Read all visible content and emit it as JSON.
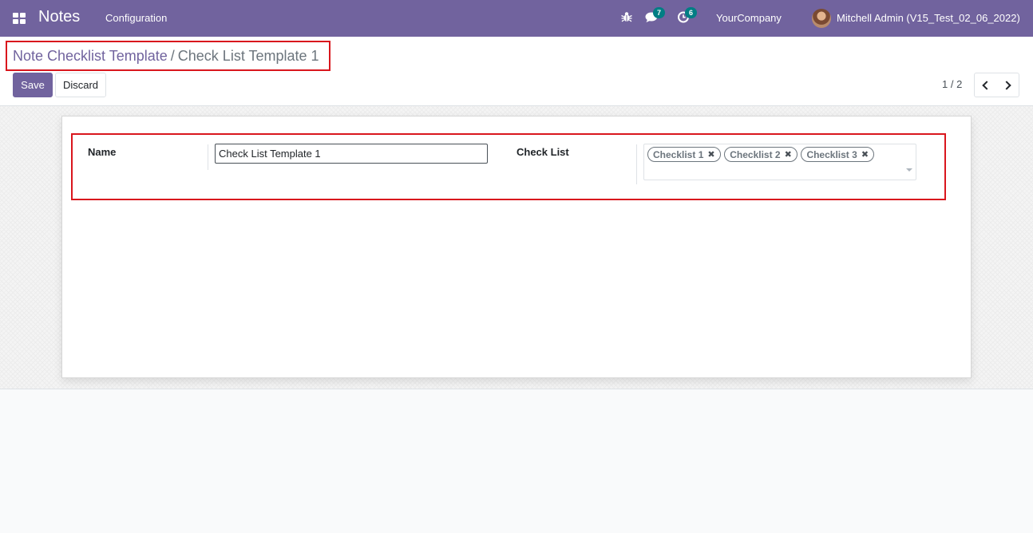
{
  "navbar": {
    "app_name": "Notes",
    "menu": [
      "Configuration"
    ],
    "messages_count": "7",
    "activities_count": "6",
    "company": "YourCompany",
    "user": "Mitchell Admin (V15_Test_02_06_2022)"
  },
  "breadcrumb": {
    "parent": "Note Checklist Template",
    "separator": "/",
    "current": "Check List Template 1"
  },
  "buttons": {
    "save": "Save",
    "discard": "Discard"
  },
  "pager": {
    "value": "1 / 2"
  },
  "form": {
    "name_label": "Name",
    "name_value": "Check List Template 1",
    "checklist_label": "Check List",
    "checklist_tags": [
      "Checklist 1",
      "Checklist 2",
      "Checklist 3"
    ]
  },
  "colors": {
    "brand": "#71639e",
    "badge": "#017e84",
    "highlight": "#d9161d"
  }
}
